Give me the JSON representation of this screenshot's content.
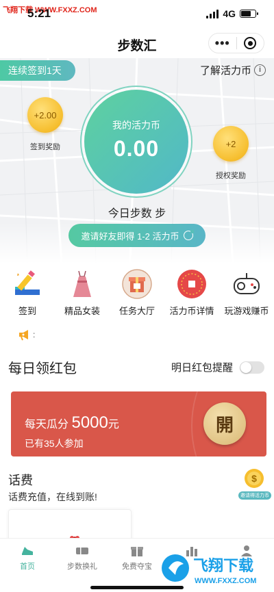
{
  "status_bar": {
    "watermark": "飞翔下载 WWW.FXXZ.COM",
    "time": "5:21",
    "network": "4G"
  },
  "nav": {
    "title": "步数汇",
    "more_glyph": "•••"
  },
  "hero": {
    "checkin_streak": "连续签到1天",
    "learn_more": "了解活力币",
    "info_glyph": "i",
    "my_coins_label": "我的活力币",
    "my_coins_value": "0.00",
    "left_coin_value": "+2.00",
    "left_coin_caption": "签到奖励",
    "right_coin_value": "+2",
    "right_coin_caption": "授权奖励",
    "today_steps": "今日步数 步",
    "invite_text": "邀请好友即得 1-2 活力币"
  },
  "features": [
    {
      "label": "签到"
    },
    {
      "label": "精品女装"
    },
    {
      "label": "任务大厅"
    },
    {
      "label": "活力币详情"
    },
    {
      "label": "玩游戏赚币"
    }
  ],
  "announcement": {
    "colon": ":"
  },
  "daily_red_packet": {
    "title": "每日领红包",
    "reminder_label": "明日红包提醒",
    "reminder_on": false,
    "line1_prefix": "每天瓜分",
    "amount": "5000",
    "unit": "元",
    "participants": "已有35人参加",
    "open_label": "開",
    "card_color": "#d9574a"
  },
  "phone_bill": {
    "title": "话费",
    "subtitle": "话费充值，在线到账!",
    "float_caption": "邀请得活力币"
  },
  "tabbar": {
    "tabs": [
      {
        "label": "首页",
        "active": true
      },
      {
        "label": "步数换礼",
        "active": false
      },
      {
        "label": "免费夺宝",
        "active": false
      },
      {
        "label": "",
        "active": false
      },
      {
        "label": "",
        "active": false
      }
    ]
  },
  "logo_watermark": {
    "text_cn": "飞翔下载",
    "text_en": "WWW.FXXZ.COM"
  },
  "colors": {
    "accent": "#4ec9a4",
    "accent2": "#59b6c7",
    "red": "#d9574a",
    "coin": "#f6be2e"
  }
}
